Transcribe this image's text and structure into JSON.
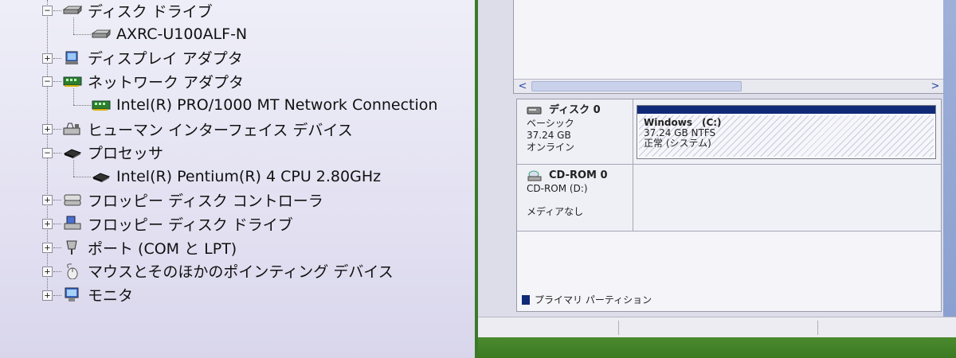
{
  "device_tree": {
    "items": [
      {
        "label": "ディスク ドライブ",
        "level": 0,
        "expander": "−",
        "icon": "disk-drive-icon"
      },
      {
        "label": "AXRC-U100ALF-N",
        "level": 1,
        "expander": "",
        "icon": "disk-drive-icon"
      },
      {
        "label": "ディスプレイ アダプタ",
        "level": 0,
        "expander": "+",
        "icon": "display-adapter-icon"
      },
      {
        "label": "ネットワーク アダプタ",
        "level": 0,
        "expander": "−",
        "icon": "network-card-icon"
      },
      {
        "label": "Intel(R) PRO/1000 MT Network Connection",
        "level": 1,
        "expander": "",
        "icon": "network-card-icon"
      },
      {
        "label": "ヒューマン インターフェイス デバイス",
        "level": 0,
        "expander": "+",
        "icon": "hid-icon"
      },
      {
        "label": "プロセッサ",
        "level": 0,
        "expander": "−",
        "icon": "processor-icon"
      },
      {
        "label": "Intel(R) Pentium(R) 4 CPU 2.80GHz",
        "level": 1,
        "expander": "",
        "icon": "processor-icon"
      },
      {
        "label": "フロッピー ディスク コントローラ",
        "level": 0,
        "expander": "+",
        "icon": "floppy-controller-icon"
      },
      {
        "label": "フロッピー ディスク ドライブ",
        "level": 0,
        "expander": "+",
        "icon": "floppy-drive-icon"
      },
      {
        "label": "ポート (COM と LPT)",
        "level": 0,
        "expander": "+",
        "icon": "port-icon"
      },
      {
        "label": "マウスとそのほかのポインティング デバイス",
        "level": 0,
        "expander": "+",
        "icon": "mouse-icon"
      },
      {
        "label": "モニタ",
        "level": 0,
        "expander": "+",
        "icon": "monitor-icon"
      }
    ]
  },
  "disk_management": {
    "scroll": {
      "left_arrow": "<",
      "right_arrow": ">"
    },
    "disk0": {
      "name": "ディスク 0",
      "type": "ベーシック",
      "size": "37.24 GB",
      "status": "オンライン",
      "partition": {
        "name": "Windows　(C:)",
        "size_fs": "37.24 GB NTFS",
        "status": "正常 (システム)"
      }
    },
    "cdrom0": {
      "name": "CD-ROM 0",
      "drive": "CD-ROM (D:)",
      "status": "メディアなし"
    },
    "legend": {
      "primary_partition": "プライマリ パーティション"
    }
  },
  "colors": {
    "partition_bar": "#102a78",
    "desktop_green": "#3c7a22"
  }
}
